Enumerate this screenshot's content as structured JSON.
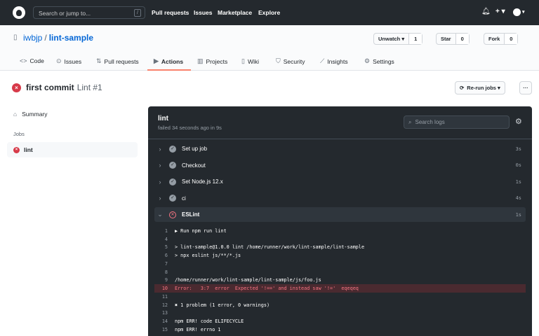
{
  "topbar": {
    "search_placeholder": "Search or jump to...",
    "slash": "/",
    "nav": [
      "Pull requests",
      "Issues",
      "Marketplace",
      "Explore"
    ],
    "plus": "+ ▾",
    "avatar": "▾"
  },
  "repo": {
    "owner": "iwbjp",
    "sep": "/",
    "name": "lint-sample",
    "unwatch": "Unwatch ▾",
    "watch_count": "1",
    "star": "Star",
    "star_count": "0",
    "fork": "Fork",
    "fork_count": "0"
  },
  "tabs": [
    {
      "icon": "<>",
      "label": "Code"
    },
    {
      "icon": "⊙",
      "label": "Issues"
    },
    {
      "icon": "⇅",
      "label": "Pull requests"
    },
    {
      "icon": "▶",
      "label": "Actions"
    },
    {
      "icon": "▥",
      "label": "Projects"
    },
    {
      "icon": "▯",
      "label": "Wiki"
    },
    {
      "icon": "⛉",
      "label": "Security"
    },
    {
      "icon": "⟋",
      "label": "Insights"
    },
    {
      "icon": "⚙",
      "label": "Settings"
    }
  ],
  "run": {
    "title": "first commit",
    "workflow": "Lint #1",
    "rerun": "Re-run jobs ▾",
    "more": "···"
  },
  "sidebar": {
    "summary": "Summary",
    "jobs_heading": "Jobs",
    "job": "lint"
  },
  "panel": {
    "title": "lint",
    "subtitle": "failed 34 seconds ago in 9s",
    "search_placeholder": "Search logs",
    "steps": [
      {
        "name": "Set up job",
        "duration": "3s"
      },
      {
        "name": "Checkout",
        "duration": "0s"
      },
      {
        "name": "Set Node.js 12.x",
        "duration": "1s"
      },
      {
        "name": "ci",
        "duration": "4s"
      },
      {
        "name": "ESLint",
        "duration": "1s"
      }
    ],
    "log": [
      {
        "n": "1",
        "t": "▶ Run npm run lint"
      },
      {
        "n": "4",
        "t": ""
      },
      {
        "n": "5",
        "t": "> lint-sample@1.0.0 lint /home/runner/work/lint-sample/lint-sample"
      },
      {
        "n": "6",
        "t": "> npx eslint js/**/*.js"
      },
      {
        "n": "7",
        "t": ""
      },
      {
        "n": "8",
        "t": ""
      },
      {
        "n": "9",
        "t": "/home/runner/work/lint-sample/lint-sample/js/foo.js"
      },
      {
        "n": "10",
        "t": "Error:   3:7  error  Expected '!==' and instead saw '!='  eqeqeq"
      },
      {
        "n": "11",
        "t": ""
      },
      {
        "n": "12",
        "t": "✖ 1 problem (1 error, 0 warnings)"
      },
      {
        "n": "13",
        "t": ""
      },
      {
        "n": "14",
        "t": "npm ERR! code ELIFECYCLE"
      },
      {
        "n": "15",
        "t": "npm ERR! errno 1"
      }
    ]
  }
}
